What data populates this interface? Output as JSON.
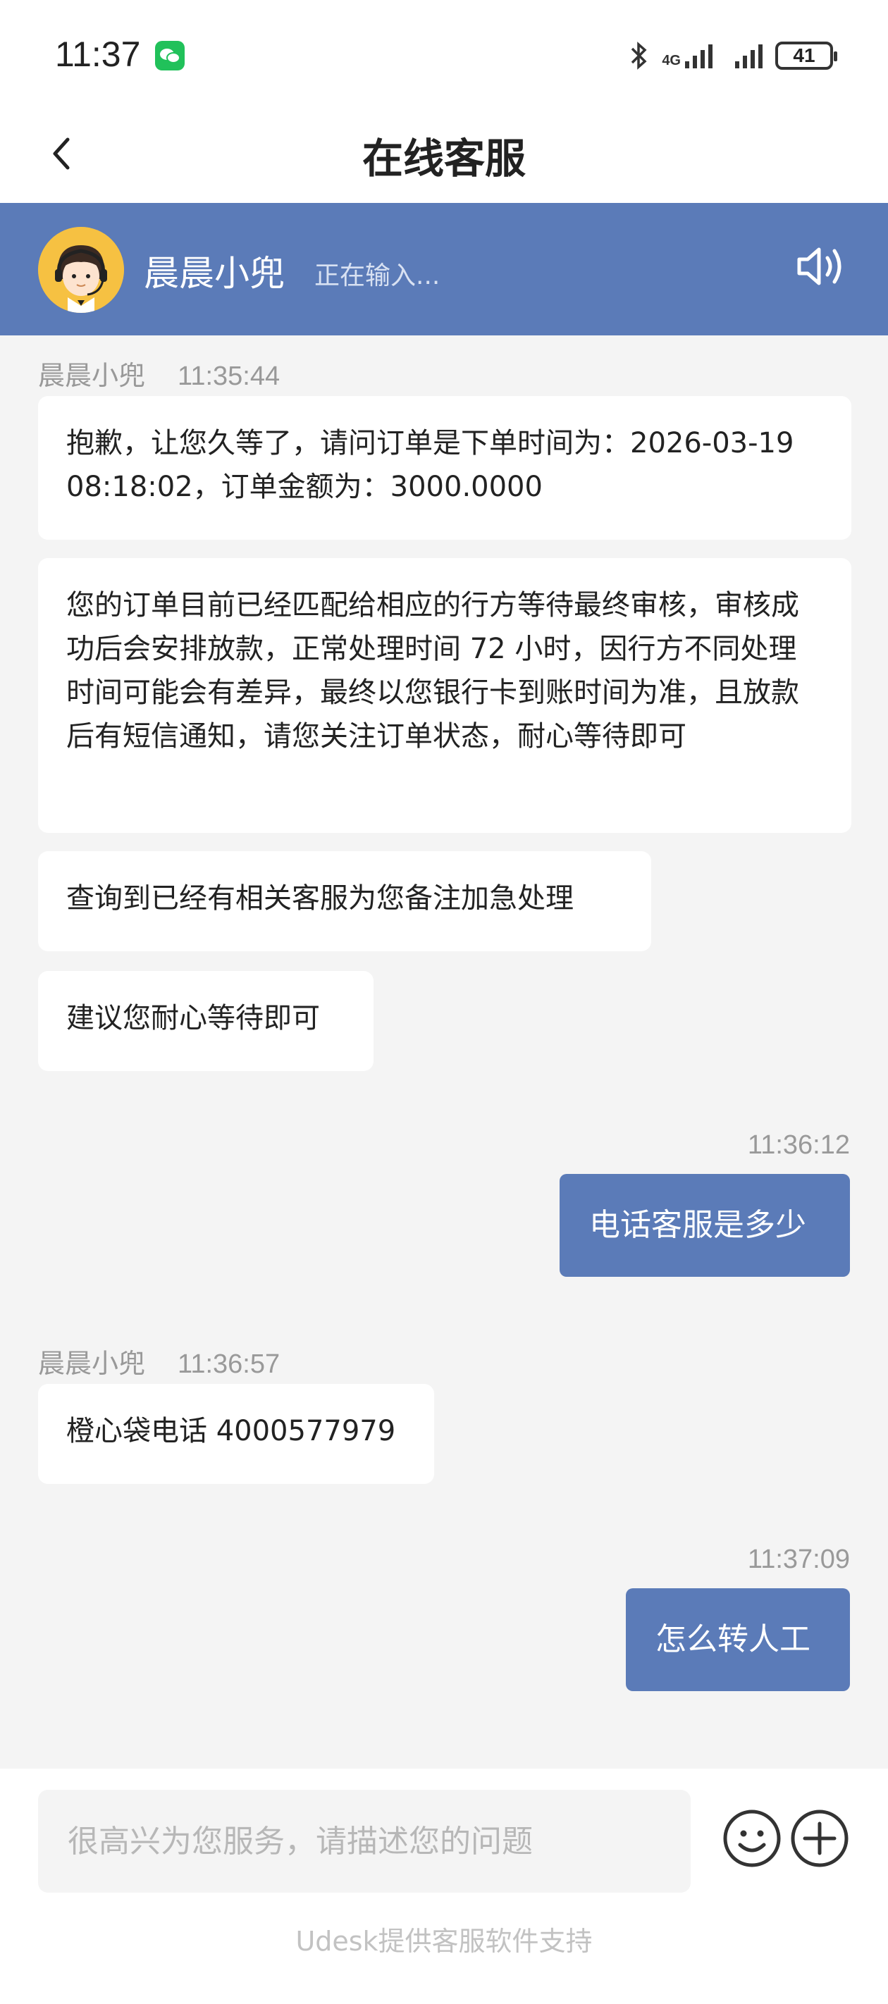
{
  "status_bar": {
    "time": "11:37",
    "network": "4G",
    "battery": "41",
    "icons": [
      "wechat-icon",
      "bluetooth-icon",
      "signal-icon",
      "battery-icon"
    ]
  },
  "header": {
    "title": "在线客服",
    "back_icon": "chevron-left-icon"
  },
  "agent": {
    "name": "晨晨小兜",
    "status": "正在输入...",
    "speaker_icon": "speaker-icon",
    "accent_color": "#5b7bb8"
  },
  "messages": [
    {
      "sender": "晨晨小兜",
      "time": "11:35:44"
    },
    {
      "text": "抱歉，让您久等了，请问订单是下单时间为：2026-03-19 08:18:02，订单金额为：3000.0000"
    },
    {
      "text": "您的订单目前已经匹配给相应的行方等待最终审核，审核成功后会安排放款，正常处理时间 72 小时，因行方不同处理时间可能会有差异，最终以您银行卡到账时间为准，且放款后有短信通知，请您关注订单状态，耐心等待即可"
    },
    {
      "text": "查询到已经有相关客服为您备注加急处理"
    },
    {
      "text": "建议您耐心等待即可"
    },
    {
      "time": "11:36:12"
    },
    {
      "text": "电话客服是多少"
    },
    {
      "sender": "晨晨小兜",
      "time": "11:36:57"
    },
    {
      "text": "橙心袋电话 4000577979"
    },
    {
      "time": "11:37:09"
    },
    {
      "text": "怎么转人工"
    }
  ],
  "composer": {
    "placeholder": "很高兴为您服务，请描述您的问题",
    "emoji_icon": "emoji-icon",
    "plus_icon": "plus-icon"
  },
  "footer": {
    "text": "Udesk提供客服软件支持"
  }
}
